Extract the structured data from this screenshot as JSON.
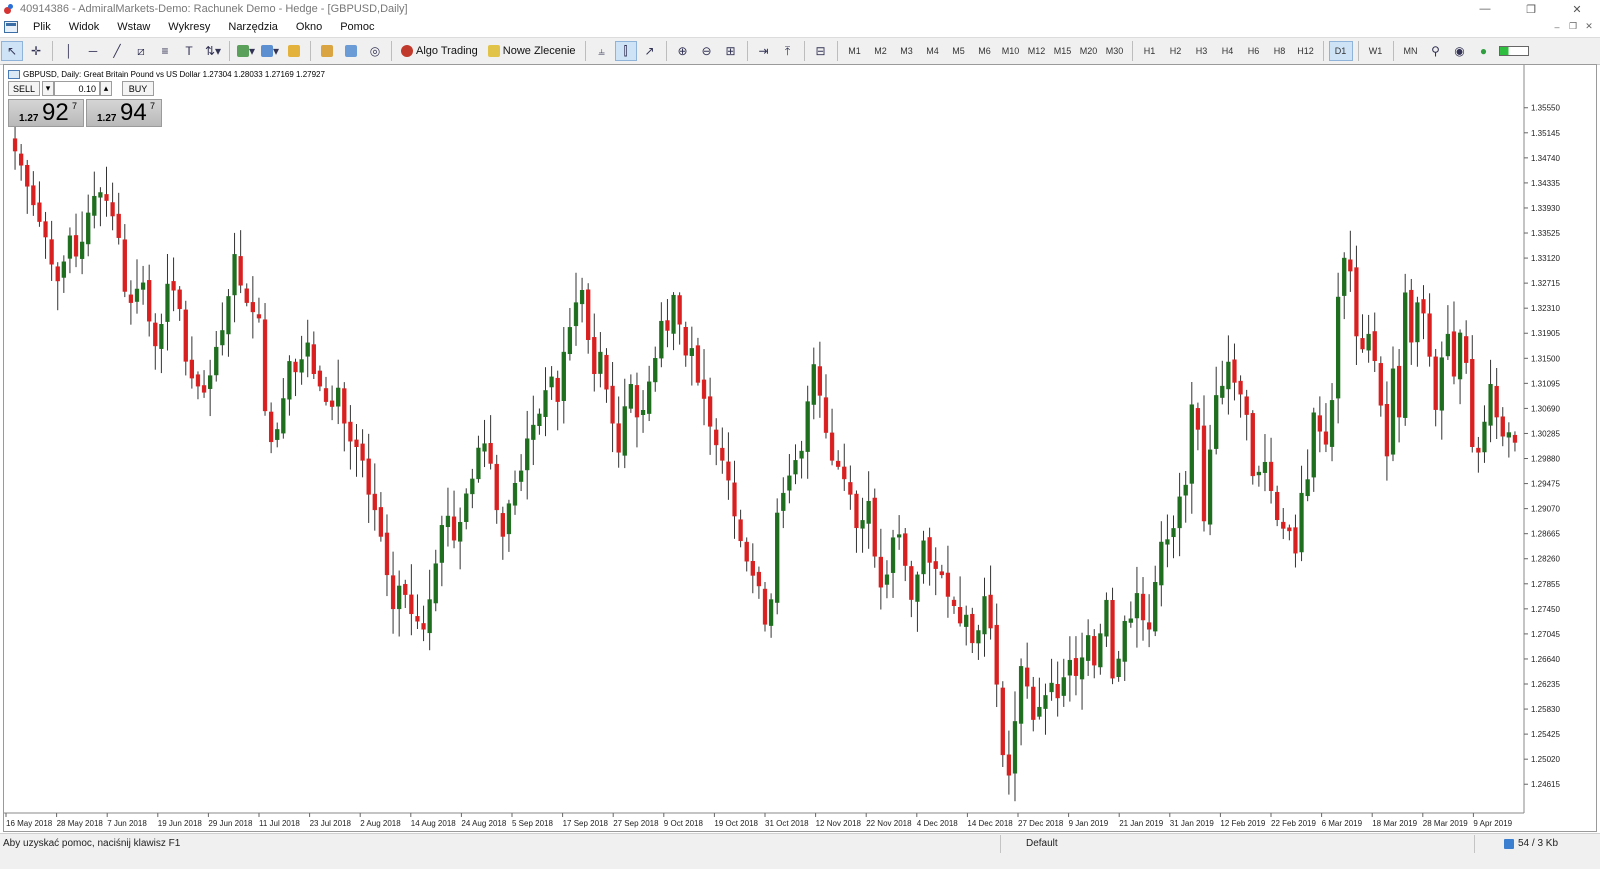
{
  "window": {
    "title": "40914386 - AdmiralMarkets-Demo: Rachunek Demo - Hedge - [GBPUSD,Daily]",
    "controls": [
      "—",
      "❐",
      "✕"
    ]
  },
  "menu": {
    "items": [
      "Plik",
      "Widok",
      "Wstaw",
      "Wykresy",
      "Narzędzia",
      "Okno",
      "Pomoc"
    ],
    "mdi_controls": [
      "–",
      "❐",
      "✕"
    ]
  },
  "toolbar": {
    "algo_label": "Algo Trading",
    "order_label": "Nowe Zlecenie",
    "timeframes": [
      "M1",
      "M2",
      "M3",
      "M4",
      "M5",
      "M6",
      "M10",
      "M12",
      "M15",
      "M20",
      "M30",
      "H1",
      "H2",
      "H3",
      "H4",
      "H6",
      "H8",
      "H12",
      "D1",
      "W1",
      "MN"
    ],
    "active_timeframe": "D1",
    "icons": [
      "cursor-icon",
      "crosshair-icon",
      "vertical-line-icon",
      "horizontal-line-icon",
      "trendline-icon",
      "equidistant-channel-icon",
      "fibonacci-icon",
      "text-icon",
      "arrows-icon",
      "new-chart-icon",
      "profiles-icon",
      "templates-icon",
      "market-watch-icon",
      "navigator-icon",
      "signals-icon",
      "bar-chart-icon",
      "candlestick-icon",
      "line-chart-icon",
      "zoom-in-icon",
      "zoom-out-icon",
      "tile-icon",
      "autoscroll-icon",
      "chart-shift-icon",
      "indicators-icon",
      "search-icon",
      "community-icon",
      "connection-icon"
    ]
  },
  "chart_header": {
    "text": "GBPUSD, Daily:  Great Britain Pound vs US Dollar  1.27304 1.28033 1.27169 1.27927"
  },
  "one_click": {
    "sell_label": "SELL",
    "buy_label": "BUY",
    "volume": "0.10",
    "sell_price_small": "1.27",
    "sell_price_big": "92",
    "sell_price_sup": "7",
    "buy_price_small": "1.27",
    "buy_price_big": "94",
    "buy_price_sup": "7"
  },
  "chart_data": {
    "type": "candlestick",
    "symbol": "GBPUSD",
    "timeframe": "Daily",
    "ylim": [
      1.2415,
      1.3595
    ],
    "yticks": [
      "1.35550",
      "1.35145",
      "1.34740",
      "1.34335",
      "1.33930",
      "1.33525",
      "1.33120",
      "1.32715",
      "1.32310",
      "1.31905",
      "1.31500",
      "1.31095",
      "1.30690",
      "1.30285",
      "1.29880",
      "1.29475",
      "1.29070",
      "1.28665",
      "1.28260",
      "1.27855",
      "1.27450",
      "1.27045",
      "1.26640",
      "1.26235",
      "1.25830",
      "1.25425",
      "1.25020",
      "1.24615"
    ],
    "xticks": [
      "16 May 2018",
      "28 May 2018",
      "7 Jun 2018",
      "19 Jun 2018",
      "29 Jun 2018",
      "11 Jul 2018",
      "23 Jul 2018",
      "2 Aug 2018",
      "14 Aug 2018",
      "24 Aug 2018",
      "5 Sep 2018",
      "17 Sep 2018",
      "27 Sep 2018",
      "9 Oct 2018",
      "19 Oct 2018",
      "31 Oct 2018",
      "12 Nov 2018",
      "22 Nov 2018",
      "4 Dec 2018",
      "14 Dec 2018",
      "27 Dec 2018",
      "9 Jan 2019",
      "21 Jan 2019",
      "31 Jan 2019",
      "12 Feb 2019",
      "22 Feb 2019",
      "6 Mar 2019",
      "18 Mar 2019",
      "28 Mar 2019",
      "9 Apr 2019"
    ],
    "bull_color": "#1f6e1f",
    "bear_color": "#d92020",
    "closes": [
      1.3485,
      1.3462,
      1.3428,
      1.3398,
      1.3371,
      1.3346,
      1.3302,
      1.3275,
      1.3306,
      1.3348,
      1.3315,
      1.3338,
      1.3385,
      1.3412,
      1.3418,
      1.3405,
      1.338,
      1.3345,
      1.3258,
      1.324,
      1.3262,
      1.3272,
      1.321,
      1.317,
      1.3205,
      1.327,
      1.326,
      1.323,
      1.3145,
      1.3118,
      1.3105,
      1.3095,
      1.3122,
      1.3168,
      1.3195,
      1.325,
      1.3318,
      1.3268,
      1.324,
      1.3225,
      1.3215,
      1.3065,
      1.3015,
      1.3035,
      1.3085,
      1.3145,
      1.3128,
      1.3148,
      1.3175,
      1.3125,
      1.3105,
      1.308,
      1.3072,
      1.3102,
      1.3045,
      1.3016,
      1.3007,
      1.2985,
      1.293,
      1.2905,
      1.2862,
      1.28,
      1.2745,
      1.2782,
      1.2768,
      1.2737,
      1.2725,
      1.2712,
      1.276,
      1.2818,
      1.288,
      1.2895,
      1.2856,
      1.2885,
      1.2931,
      1.2955,
      1.3005,
      1.3012,
      1.298,
      1.2905,
      1.2862,
      1.2915,
      1.2948,
      1.2968,
      1.302,
      1.3042,
      1.306,
      1.3098,
      1.312,
      1.308,
      1.316,
      1.32,
      1.324,
      1.326,
      1.318,
      1.3125,
      1.316,
      1.31,
      1.3045,
      1.2998,
      1.3072,
      1.3108,
      1.3055,
      1.3066,
      1.3112,
      1.315,
      1.321,
      1.3195,
      1.3252,
      1.3205,
      1.3155,
      1.3166,
      1.3111,
      1.3085,
      1.304,
      1.301,
      1.2985,
      1.2953,
      1.2895,
      1.2855,
      1.2822,
      1.2799,
      1.2782,
      1.272,
      1.276,
      1.29,
      1.2932,
      1.296,
      1.2985,
      1.3,
      1.308,
      1.314,
      1.309,
      1.303,
      1.2985,
      1.2975,
      1.2955,
      1.293,
      1.2876,
      1.2888,
      1.2919,
      1.283,
      1.278,
      1.28,
      1.286,
      1.2865,
      1.2815,
      1.276,
      1.28,
      1.2855,
      1.282,
      1.281,
      1.28,
      1.2765,
      1.275,
      1.2722,
      1.2735,
      1.269,
      1.271,
      1.2765,
      1.2714,
      1.2623,
      1.2509,
      1.2476,
      1.2563,
      1.2652,
      1.262,
      1.2566,
      1.2586,
      1.2605,
      1.2625,
      1.2601,
      1.2634,
      1.2662,
      1.2637,
      1.2666,
      1.2702,
      1.2654,
      1.2705,
      1.2759,
      1.2633,
      1.2664,
      1.2725,
      1.2729,
      1.277,
      1.2727,
      1.2712,
      1.2788,
      1.2853,
      1.2857,
      1.2875,
      1.2926,
      1.2945,
      1.3075,
      1.3035,
      1.2887,
      1.3002,
      1.309,
      1.3105,
      1.3144,
      1.3111,
      1.3092,
      1.3059,
      1.296,
      1.2966,
      1.2982,
      1.2936,
      1.2889,
      1.2875,
      1.2871,
      1.2835,
      1.2932,
      1.2954,
      1.3062,
      1.3032,
      1.3011,
      1.3082,
      1.3249,
      1.3312,
      1.3291,
      1.3186,
      1.3165,
      1.3189,
      1.3146,
      1.3074,
      1.2992,
      1.3133,
      1.3055,
      1.3256,
      1.3176,
      1.324,
      1.3223,
      1.3153,
      1.3067,
      1.3151,
      1.3189,
      1.3121,
      1.3191,
      1.3143,
      1.3007,
      1.2998,
      1.3047,
      1.3108,
      1.3055,
      1.3024,
      1.303,
      1.3014
    ],
    "ohlc_visible_last": [
      1.27304,
      1.28033,
      1.27169,
      1.27927
    ]
  },
  "status": {
    "help": "Aby uzyskać pomoc, naciśnij klawisz F1",
    "profile": "Default",
    "traffic": "54 / 3 Kb"
  }
}
